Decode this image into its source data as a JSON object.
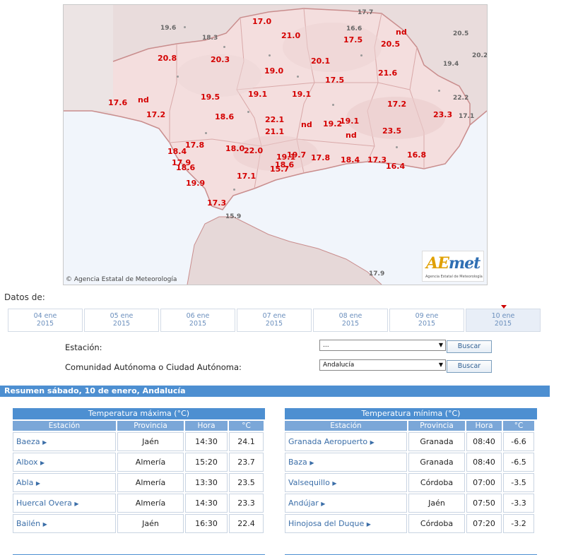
{
  "map": {
    "copyright": "© Agencia Estatal de Meteorología",
    "logo_text_a": "AE",
    "logo_text_b": "met",
    "logo_subtitle": "Agencia Estatal de Meteorología",
    "red_values": [
      {
        "id": "v1",
        "text": "17.0"
      },
      {
        "id": "v2",
        "text": "21.0"
      },
      {
        "id": "v3",
        "text": "17.5"
      },
      {
        "id": "v4",
        "text": "nd"
      },
      {
        "id": "v5",
        "text": "20.5"
      },
      {
        "id": "v6",
        "text": "20.8"
      },
      {
        "id": "v7",
        "text": "20.3"
      },
      {
        "id": "v8",
        "text": "20.1"
      },
      {
        "id": "v9",
        "text": "19.0"
      },
      {
        "id": "v10",
        "text": "21.6"
      },
      {
        "id": "v11",
        "text": "17.5"
      },
      {
        "id": "v12",
        "text": "19.5"
      },
      {
        "id": "v13",
        "text": "19.1"
      },
      {
        "id": "v14",
        "text": "19.1"
      },
      {
        "id": "v15",
        "text": "17.6"
      },
      {
        "id": "v16",
        "text": "nd"
      },
      {
        "id": "v17",
        "text": "17.2"
      },
      {
        "id": "v18",
        "text": "18.6"
      },
      {
        "id": "v19",
        "text": "22.1"
      },
      {
        "id": "v20",
        "text": "17.2"
      },
      {
        "id": "v21",
        "text": "23.3"
      },
      {
        "id": "v22",
        "text": "nd"
      },
      {
        "id": "v23",
        "text": "19.2"
      },
      {
        "id": "v24",
        "text": "19.1"
      },
      {
        "id": "v25",
        "text": "21.1"
      },
      {
        "id": "v26",
        "text": "nd"
      },
      {
        "id": "v27",
        "text": "23.5"
      },
      {
        "id": "v28",
        "text": "17.8"
      },
      {
        "id": "v29",
        "text": "18.4"
      },
      {
        "id": "v30",
        "text": "18.0"
      },
      {
        "id": "v31",
        "text": "22.0"
      },
      {
        "id": "v32",
        "text": "19.1"
      },
      {
        "id": "v33",
        "text": "19.7"
      },
      {
        "id": "v34",
        "text": "17.8"
      },
      {
        "id": "v35",
        "text": "18.4"
      },
      {
        "id": "v36",
        "text": "17.3"
      },
      {
        "id": "v37",
        "text": "16.8"
      },
      {
        "id": "v38",
        "text": "17.9"
      },
      {
        "id": "v39",
        "text": "18.6"
      },
      {
        "id": "v40",
        "text": "18.6"
      },
      {
        "id": "v41",
        "text": "15.7"
      },
      {
        "id": "v42",
        "text": "16.4"
      },
      {
        "id": "v43",
        "text": "17.1"
      },
      {
        "id": "v44",
        "text": "19.9"
      },
      {
        "id": "v45",
        "text": "17.3"
      }
    ],
    "grey_values": [
      {
        "id": "g1",
        "text": "17.7"
      },
      {
        "id": "g2",
        "text": "19.6"
      },
      {
        "id": "g3",
        "text": "18.3"
      },
      {
        "id": "g4",
        "text": "16.6"
      },
      {
        "id": "g5",
        "text": "20.5"
      },
      {
        "id": "g6",
        "text": "20.2"
      },
      {
        "id": "g7",
        "text": "19.4"
      },
      {
        "id": "g8",
        "text": "22.2"
      },
      {
        "id": "g9",
        "text": "17.1"
      },
      {
        "id": "g10",
        "text": "15.9"
      },
      {
        "id": "g11",
        "text": "17.9"
      }
    ]
  },
  "datos_label": "Datos de:",
  "dates": [
    {
      "day": "04 ene",
      "year": "2015"
    },
    {
      "day": "05 ene",
      "year": "2015"
    },
    {
      "day": "06 ene",
      "year": "2015"
    },
    {
      "day": "07 ene",
      "year": "2015"
    },
    {
      "day": "08 ene",
      "year": "2015"
    },
    {
      "day": "09 ene",
      "year": "2015"
    },
    {
      "day": "10 ene",
      "year": "2015"
    }
  ],
  "form": {
    "station_label": "Estación:",
    "station_value": "...",
    "community_label": "Comunidad Autónoma o Ciudad Autónoma:",
    "community_value": "Andalucía",
    "search_label": "Buscar"
  },
  "summary_title": "Resumen sábado, 10 de enero, Andalucía",
  "max_table": {
    "caption": "Temperatura máxima (°C)",
    "headers": [
      "Estación",
      "Provincia",
      "Hora",
      "°C"
    ],
    "rows": [
      {
        "station": "Baeza",
        "province": "Jaén",
        "time": "14:30",
        "temp": "24.1"
      },
      {
        "station": "Albox",
        "province": "Almería",
        "time": "15:20",
        "temp": "23.7"
      },
      {
        "station": "Abla",
        "province": "Almería",
        "time": "13:30",
        "temp": "23.5"
      },
      {
        "station": "Huercal Overa",
        "province": "Almería",
        "time": "14:30",
        "temp": "23.3"
      },
      {
        "station": "Bailén",
        "province": "Jaén",
        "time": "16:30",
        "temp": "22.4"
      }
    ]
  },
  "min_table": {
    "caption": "Temperatura mínima (°C)",
    "headers": [
      "Estación",
      "Provincia",
      "Hora",
      "°C"
    ],
    "rows": [
      {
        "station": "Granada Aeropuerto",
        "province": "Granada",
        "time": "08:40",
        "temp": "-6.6"
      },
      {
        "station": "Baza",
        "province": "Granada",
        "time": "08:40",
        "temp": "-6.5"
      },
      {
        "station": "Valsequillo",
        "province": "Córdoba",
        "time": "07:00",
        "temp": "-3.5"
      },
      {
        "station": "Andújar",
        "province": "Jaén",
        "time": "07:50",
        "temp": "-3.3"
      },
      {
        "station": "Hinojosa del Duque",
        "province": "Córdoba",
        "time": "07:20",
        "temp": "-3.2"
      }
    ]
  }
}
